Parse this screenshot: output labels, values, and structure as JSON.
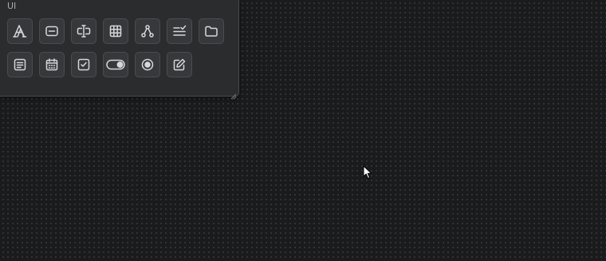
{
  "panel": {
    "title": "UI",
    "row1": [
      {
        "icon": "typography-icon"
      },
      {
        "icon": "text-input-icon"
      },
      {
        "icon": "text-cursor-input-icon"
      },
      {
        "icon": "table-grid-icon"
      },
      {
        "icon": "tree-hierarchy-icon"
      },
      {
        "icon": "checklist-icon"
      },
      {
        "icon": "folder-icon"
      }
    ],
    "row2": [
      {
        "icon": "text-area-icon"
      },
      {
        "icon": "calendar-icon"
      },
      {
        "icon": "checkbox-icon"
      },
      {
        "icon": "toggle-switch-icon"
      },
      {
        "icon": "radio-button-icon"
      },
      {
        "icon": "edit-pencil-icon"
      }
    ]
  },
  "colors": {
    "canvas_background": "#1a1b1d",
    "canvas_dot": "#34363a",
    "panel_background": "#2b2c2e",
    "tile_background": "#37383b",
    "icon_stroke": "#d6d7d9"
  }
}
